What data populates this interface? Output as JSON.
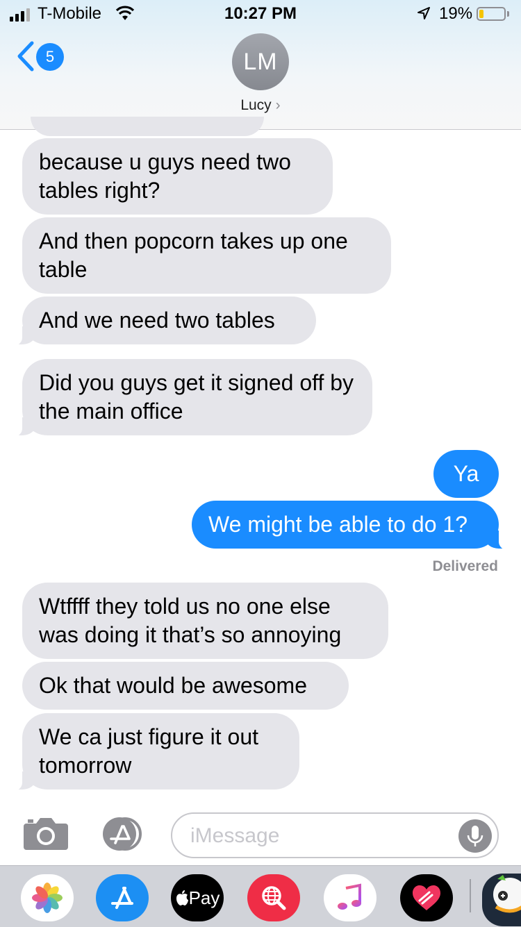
{
  "status_bar": {
    "carrier": "T-Mobile",
    "time": "10:27 PM",
    "battery_percent": "19%",
    "battery_level": 0.19
  },
  "header": {
    "back_badge": "5",
    "avatar_initials": "LM",
    "contact_name": "Lucy"
  },
  "messages": [
    {
      "from": "them",
      "text": "because u guys need two tables right?"
    },
    {
      "from": "them",
      "text": "And then popcorn takes up one table"
    },
    {
      "from": "them",
      "text": "And we need two tables"
    },
    {
      "from": "them",
      "text": "Did you guys get it signed off by the main office"
    },
    {
      "from": "me",
      "text": "Ya"
    },
    {
      "from": "me",
      "text": "We might be able to do 1?"
    },
    {
      "from": "them",
      "text": "Wtffff they told us no one else was doing it that’s so annoying"
    },
    {
      "from": "them",
      "text": "Ok that would be awesome"
    },
    {
      "from": "them",
      "text": "We ca just figure it out tomorrow"
    }
  ],
  "delivered_label": "Delivered",
  "input": {
    "placeholder": "iMessage",
    "value": ""
  },
  "app_drawer": {
    "pay_label": "Pay",
    "apps": [
      "photos-icon",
      "app-store-icon",
      "apple-pay-icon",
      "web-search-icon",
      "music-icon",
      "heart-app-icon",
      "game-app-icon"
    ]
  },
  "colors": {
    "incoming_bubble": "#e5e5ea",
    "outgoing_bubble": "#1a8cff",
    "badge": "#1a8cff",
    "battery_fill": "#f5c400"
  }
}
